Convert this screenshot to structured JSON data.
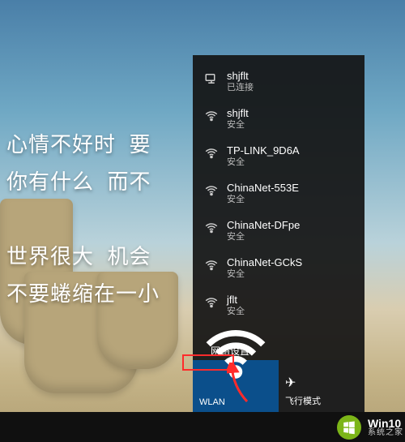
{
  "wallpaper": {
    "lines": "心情不好时  要\n你有什么  而不\n\n世界很大  机会\n不要蜷缩在一小"
  },
  "network": {
    "items": [
      {
        "name": "shjflt",
        "sub": "已连接",
        "icon": "ethernet"
      },
      {
        "name": "shjflt",
        "sub": "安全",
        "icon": "wifi"
      },
      {
        "name": "TP-LINK_9D6A",
        "sub": "安全",
        "icon": "wifi"
      },
      {
        "name": "ChinaNet-553E",
        "sub": "安全",
        "icon": "wifi"
      },
      {
        "name": "ChinaNet-DFpe",
        "sub": "安全",
        "icon": "wifi"
      },
      {
        "name": "ChinaNet-GCkS",
        "sub": "安全",
        "icon": "wifi"
      },
      {
        "name": "jflt",
        "sub": "安全",
        "icon": "wifi"
      }
    ],
    "settings_label": "网络设置",
    "tiles": {
      "wlan": "WLAN",
      "airplane": "飞行模式"
    }
  },
  "watermark": {
    "line1": "Win10",
    "line2": "系统之家"
  }
}
